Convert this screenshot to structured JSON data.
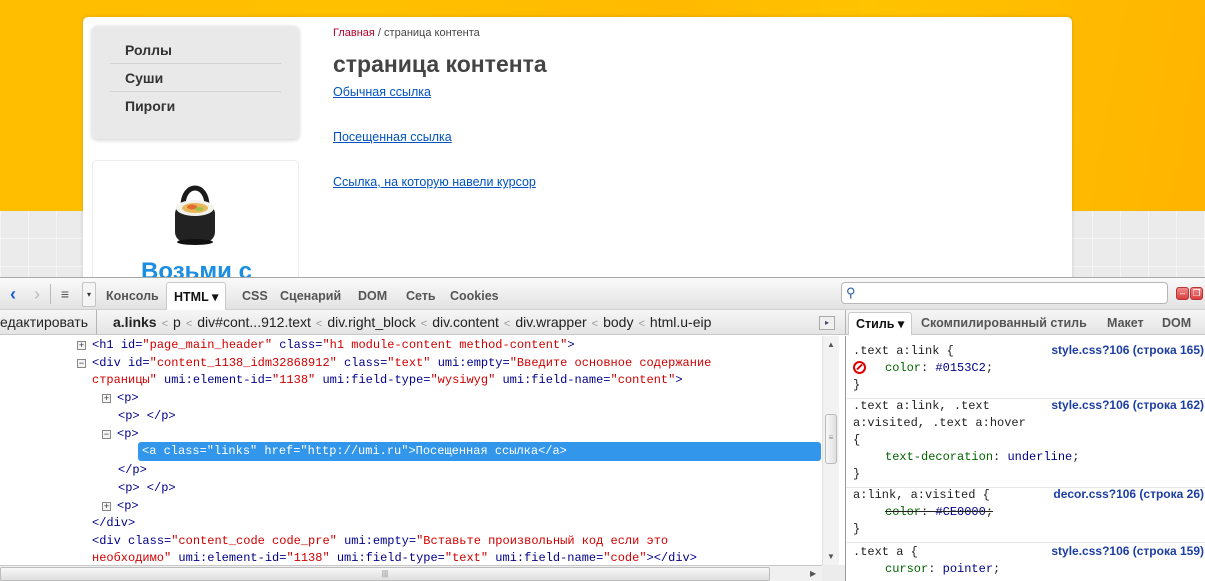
{
  "site": {
    "menu": [
      {
        "label": "Роллы"
      },
      {
        "label": "Суши"
      },
      {
        "label": "Пироги"
      }
    ],
    "promo": {
      "text": "Возьми с",
      "image": "sushi-bag-image"
    },
    "breadcrumb": {
      "home": "Главная",
      "separator": " / ",
      "current": "страница контента"
    },
    "title": "страница контента",
    "links": [
      {
        "label": "Обычная ссылка"
      },
      {
        "label": "Посещенная ссылка"
      },
      {
        "label": "Ссылка, на которую навели курсор"
      }
    ],
    "colors": {
      "accent_orange": "#ffc000",
      "link": "#0153c2",
      "breadcrumb_home": "#b5002b",
      "promo_text": "#1a8ee1"
    }
  },
  "firebug": {
    "toolbar": {
      "back_icon": "‹",
      "forward_icon": "›",
      "menu_icon": "≡",
      "dropdown_icon": "▾",
      "tabs": [
        {
          "label": "Консоль",
          "active": false
        },
        {
          "label": "HTML ▾",
          "active": true
        },
        {
          "label": "CSS",
          "active": false
        },
        {
          "label": "Сценарий",
          "active": false
        },
        {
          "label": "DOM",
          "active": false
        },
        {
          "label": "Сеть",
          "active": false
        },
        {
          "label": "Cookies",
          "active": false
        }
      ],
      "search_value": "",
      "search_icon": "⚲",
      "minimize_icon": "–",
      "detach_icon": "❐"
    },
    "edit_label": "едактировать",
    "breadcrumbs": [
      "a.links",
      "p",
      "div#cont...912.text",
      "div.right_block",
      "div.content",
      "div.wrapper",
      "body",
      "html.u-eip"
    ],
    "breadcrumb_separator": "<",
    "breadcrumb_more_icon": "▸",
    "side_tabs": [
      {
        "label": "Стиль ▾",
        "active": true
      },
      {
        "label": "Скомпилированный стиль",
        "active": false
      },
      {
        "label": "Макет",
        "active": false
      },
      {
        "label": "DOM",
        "active": false
      }
    ],
    "html_tree": {
      "h1": {
        "tag_open": "<h1 ",
        "id_attr": "id=",
        "id_val": "\"page_main_header\"",
        "class_attr": " class=",
        "class_val": "\"h1 module-content method-content\"",
        "close": ">"
      },
      "div_content": {
        "line1": {
          "tag_open": "<div ",
          "a1": "id=",
          "v1": "\"content_1138_idm32868912\"",
          "a2": " class=",
          "v2": "\"text\"",
          "a3": " umi:empty=",
          "v3": "\"Введите основное содержание"
        },
        "line2": {
          "v3b": "страницы\"",
          "a4": " umi:element-id=",
          "v4": "\"1138\"",
          "a5": " umi:field-type=",
          "v5": "\"wysiwyg\"",
          "a6": " umi:field-name=",
          "v6": "\"content\"",
          "close": ">"
        }
      },
      "p1": "<p>",
      "p_empty": "<p> </p>",
      "p_open": "<p>",
      "selected": "<a class=\"links\" href=\"http://umi.ru\">Посещенная ссылка</a>",
      "p_close": "</p>",
      "p_empty2": "<p> </p>",
      "p_last": "<p>",
      "div_close": "</div>",
      "div_code": {
        "line1": {
          "tag_open": "<div ",
          "a1": "class=",
          "v1": "\"content_code code_pre\"",
          "a2": " umi:empty=",
          "v2": "\"Вставьте произвольный код если это"
        },
        "line2": {
          "v2b": "необходимо\"",
          "a3": " umi:element-id=",
          "v3": "\"1138\"",
          "a4": " umi:field-type=",
          "v4": "\"text\"",
          "a5": " umi:field-name=",
          "v5": "\"code\"",
          "close": "></div>"
        }
      },
      "expand_icon": "+",
      "collapse_icon": "−"
    },
    "styles": [
      {
        "selector": ".text a:link {",
        "source": "style.css?106 (строка 165)",
        "props": [
          {
            "name": "color",
            "value": "#0153C2",
            "disabled": true
          }
        ],
        "close": "}"
      },
      {
        "selector_lines": [
          ".text a:link, .text",
          "a:visited, .text a:hover",
          "{"
        ],
        "source": "style.css?106 (строка 162)",
        "props": [
          {
            "name": "text-decoration",
            "value": "underline"
          }
        ],
        "close": "}"
      },
      {
        "selector": "a:link, a:visited {",
        "source": "decor.css?106 (строка 26)",
        "props": [
          {
            "name": "color",
            "value": "#CE0000",
            "overridden": true
          }
        ],
        "close": "}"
      },
      {
        "selector": ".text a {",
        "source": "style.css?106 (строка 159)",
        "props": [
          {
            "name": "cursor",
            "value": "pointer"
          }
        ]
      }
    ]
  }
}
